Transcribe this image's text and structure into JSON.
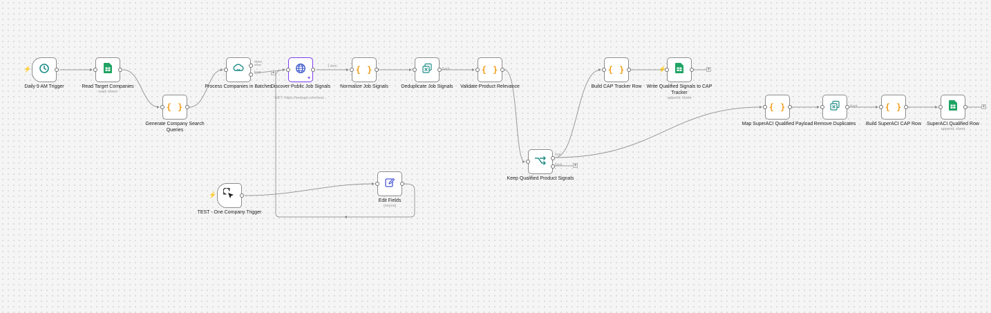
{
  "colors": {
    "canvas_background": "#f5f5f5",
    "wire": "#9a9a9a",
    "trigger_bolt": "#f07b2d",
    "code_braces": "#f29d1b",
    "sheets_green": "#1fa463",
    "teal_icon": "#1e8c86",
    "selected_purple": "#7c3aed",
    "edit_blue": "#4a57d6"
  },
  "nodes": {
    "daily_trigger": {
      "label": "Daily 9 AM Trigger",
      "icon": "clock-icon"
    },
    "read_target": {
      "label": "Read Target Companies",
      "sub": "read: sheet",
      "icon": "google-sheets-icon"
    },
    "generate_queries": {
      "label": "Generate Company Search Queries",
      "icon": "code-braces-icon"
    },
    "process_batches": {
      "label": "Process Companies in Batches",
      "icon": "loop-icon",
      "out_done": "done",
      "out_loop": "loop"
    },
    "discover_signals": {
      "label": "Discover Public Job Signals",
      "sub": "GET: https://serpapi.com/sea...",
      "icon": "globe-icon",
      "edge_label": "1 item"
    },
    "normalize": {
      "label": "Normalize Job Signals",
      "icon": "code-braces-icon"
    },
    "deduplicate": {
      "label": "Deduplicate Job Signals",
      "icon": "remove-duplicates-icon",
      "out_label": "Kept"
    },
    "validate": {
      "label": "Validate Product Relevance",
      "icon": "code-braces-icon"
    },
    "keep_qualified": {
      "label": "Keep Qualified Product Signals",
      "icon": "filter-icon",
      "out_true": "true",
      "out_false": "false"
    },
    "build_cap": {
      "label": "Build CAP Tracker Row",
      "icon": "code-braces-icon"
    },
    "write_signals": {
      "label": "Write Qualified Signals to CAP Tracker",
      "sub": "append: sheet",
      "icon": "google-sheets-icon"
    },
    "map_superaci": {
      "label": "Map SuperACI Qualified Payload",
      "icon": "code-braces-icon"
    },
    "remove_duplicates": {
      "label": "Remove Duplicates",
      "icon": "remove-duplicates-icon",
      "out_label": "Kept"
    },
    "build_superaci_cap": {
      "label": "Build SuperACI CAP Row",
      "icon": "code-braces-icon"
    },
    "superaci_row": {
      "label": "SuperACI Qualified Row",
      "sub": "append: sheet",
      "icon": "google-sheets-icon"
    },
    "test_trigger": {
      "label": "TEST - One Company Trigger",
      "icon": "cursor-click-icon"
    },
    "edit_fields": {
      "label": "Edit Fields",
      "sub": "manual",
      "icon": "pencil-icon"
    }
  }
}
